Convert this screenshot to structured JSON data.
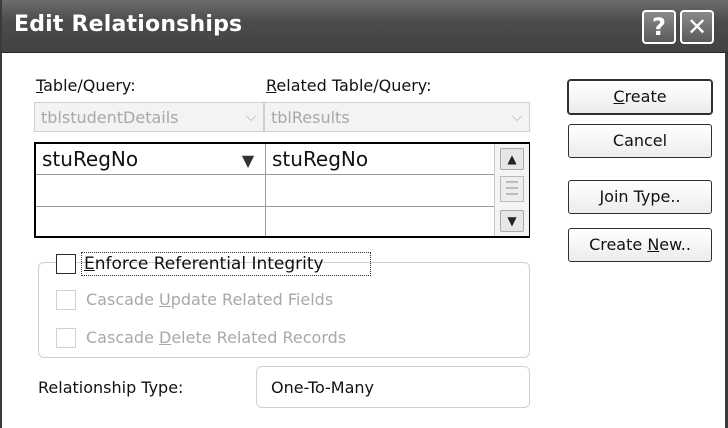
{
  "dialog": {
    "title": "Edit Relationships",
    "help_glyph": "?",
    "close_glyph": "✕"
  },
  "labels": {
    "table_query_prefix": "",
    "table_query_accel": "T",
    "table_query_rest": "able/Query:",
    "related_accel": "R",
    "related_rest": "elated Table/Query:"
  },
  "combos": {
    "table": {
      "value": "tblstudentDetails"
    },
    "related": {
      "value": "tblResults"
    }
  },
  "grid": {
    "rows": [
      {
        "left": "stuRegNo",
        "right": "stuRegNo"
      },
      {
        "left": "",
        "right": ""
      },
      {
        "left": "",
        "right": ""
      }
    ]
  },
  "options": {
    "enforce_accel": "E",
    "enforce_rest": "nforce Referential Integrity",
    "cascade_update_pre": "Cascade ",
    "cascade_update_accel": "U",
    "cascade_update_rest": "pdate Related Fields",
    "cascade_delete_pre": "Cascade ",
    "cascade_delete_accel": "D",
    "cascade_delete_rest": "elete Related Records"
  },
  "relationship": {
    "label": "Relationship Type:",
    "value": "One-To-Many"
  },
  "buttons": {
    "create_accel": "C",
    "create_rest": "reate",
    "cancel": "Cancel",
    "join_accel": "J",
    "join_rest": "oin Type..",
    "create_new_pre": "Create ",
    "create_new_accel": "N",
    "create_new_rest": "ew.."
  }
}
